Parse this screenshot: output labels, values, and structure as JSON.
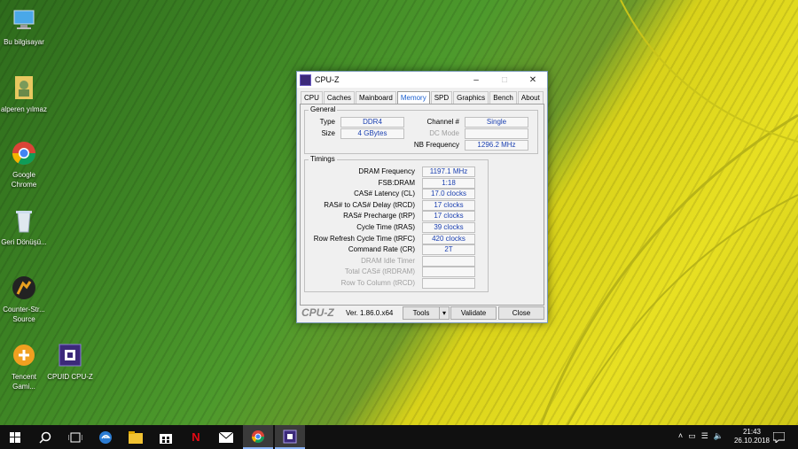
{
  "desktop_icons": [
    {
      "label": "Bu bilgisayar"
    },
    {
      "label": "alperen yılmaz"
    },
    {
      "label": "Google Chrome"
    },
    {
      "label": "Geri Dönüşü..."
    },
    {
      "label": "Counter-Str... Source"
    },
    {
      "label": "Tencent Gami..."
    },
    {
      "label": "CPUID CPU-Z"
    }
  ],
  "window": {
    "title": "CPU-Z",
    "tabs": [
      "CPU",
      "Caches",
      "Mainboard",
      "Memory",
      "SPD",
      "Graphics",
      "Bench",
      "About"
    ],
    "active_tab": "Memory",
    "general": {
      "title": "General",
      "type_label": "Type",
      "type_value": "DDR4",
      "size_label": "Size",
      "size_value": "4 GBytes",
      "channel_label": "Channel #",
      "channel_value": "Single",
      "dcmode_label": "DC Mode",
      "dcmode_value": "",
      "nbfreq_label": "NB Frequency",
      "nbfreq_value": "1296.2 MHz"
    },
    "timings": {
      "title": "Timings",
      "rows": [
        {
          "label": "DRAM Frequency",
          "value": "1197.1 MHz"
        },
        {
          "label": "FSB:DRAM",
          "value": "1:18"
        },
        {
          "label": "CAS# Latency (CL)",
          "value": "17.0 clocks"
        },
        {
          "label": "RAS# to CAS# Delay (tRCD)",
          "value": "17 clocks"
        },
        {
          "label": "RAS# Precharge (tRP)",
          "value": "17 clocks"
        },
        {
          "label": "Cycle Time (tRAS)",
          "value": "39 clocks"
        },
        {
          "label": "Row Refresh Cycle Time (tRFC)",
          "value": "420 clocks"
        },
        {
          "label": "Command Rate (CR)",
          "value": "2T"
        },
        {
          "label": "DRAM Idle Timer",
          "value": ""
        },
        {
          "label": "Total CAS# (tRDRAM)",
          "value": ""
        },
        {
          "label": "Row To Column (tRCD)",
          "value": ""
        }
      ]
    },
    "footer": {
      "logo": "CPU-Z",
      "version": "Ver. 1.86.0.x64",
      "tools": "Tools",
      "validate": "Validate",
      "close": "Close"
    }
  },
  "taskbar": {
    "time": "21:43",
    "date": "26.10.2018"
  }
}
